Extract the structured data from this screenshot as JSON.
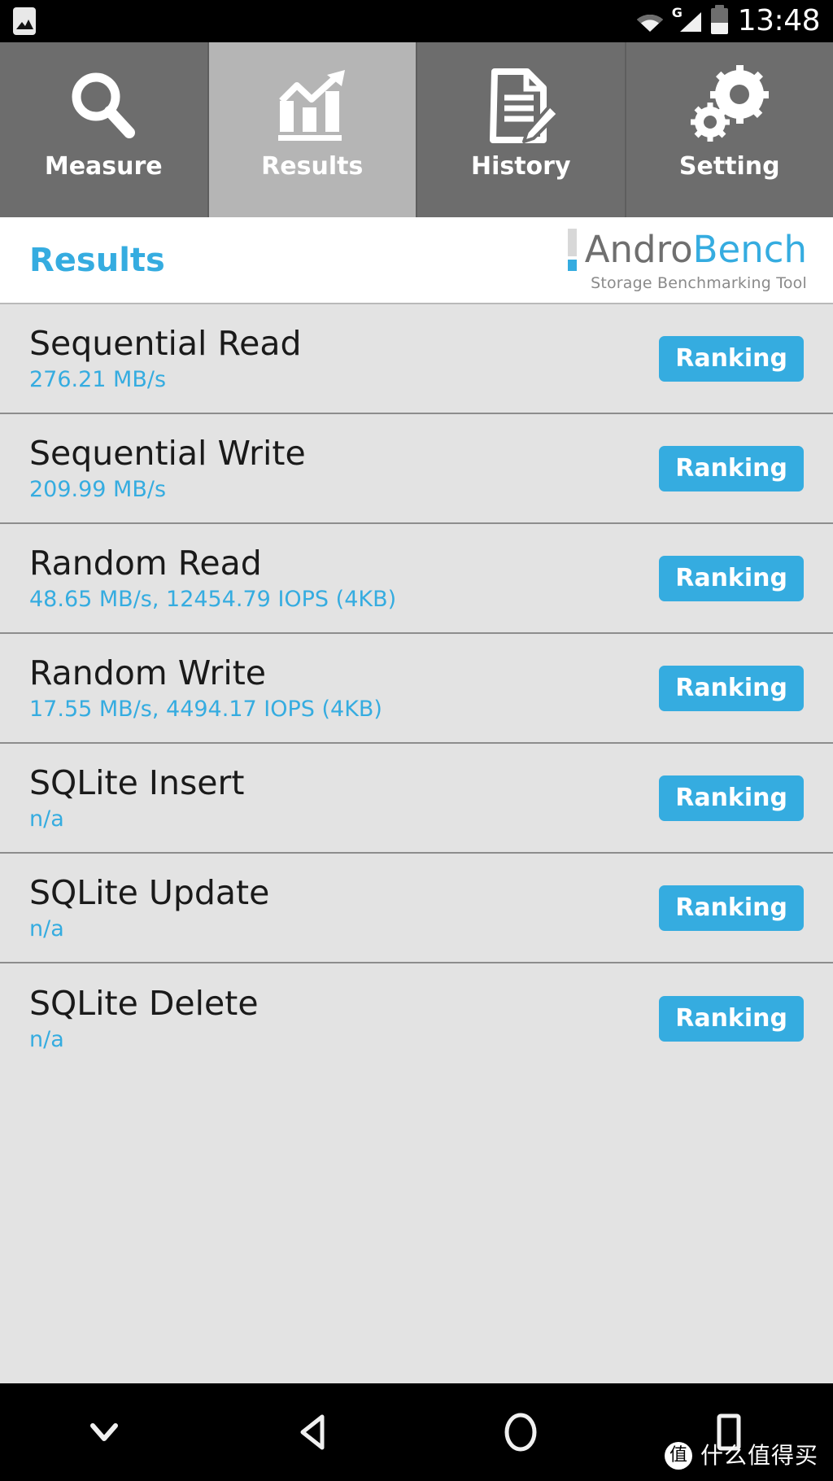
{
  "status_bar": {
    "time": "13:48",
    "icons": {
      "notification": "gallery-icon",
      "wifi": "wifi-icon",
      "signal": "signal-icon",
      "network_type": "G",
      "battery": "battery-icon"
    }
  },
  "tabs": [
    {
      "label": "Measure",
      "icon": "magnifier-icon",
      "active": false
    },
    {
      "label": "Results",
      "icon": "bar-chart-icon",
      "active": true
    },
    {
      "label": "History",
      "icon": "document-pen-icon",
      "active": false
    },
    {
      "label": "Setting",
      "icon": "gears-icon",
      "active": false
    }
  ],
  "header": {
    "title": "Results",
    "logo_part1": "Andro",
    "logo_part2": "Bench",
    "tagline": "Storage Benchmarking Tool"
  },
  "results": {
    "button_label": "Ranking",
    "rows": [
      {
        "title": "Sequential Read",
        "value": "276.21 MB/s"
      },
      {
        "title": "Sequential Write",
        "value": "209.99 MB/s"
      },
      {
        "title": "Random Read",
        "value": "48.65 MB/s, 12454.79 IOPS (4KB)"
      },
      {
        "title": "Random Write",
        "value": "17.55 MB/s, 4494.17 IOPS (4KB)"
      },
      {
        "title": "SQLite Insert",
        "value": "n/a"
      },
      {
        "title": "SQLite Update",
        "value": "n/a"
      },
      {
        "title": "SQLite Delete",
        "value": "n/a"
      }
    ]
  },
  "nav_bar": {
    "buttons": [
      {
        "name": "hide-keyboard-button",
        "icon": "chevron-down-icon"
      },
      {
        "name": "back-button",
        "icon": "triangle-back-icon"
      },
      {
        "name": "home-button",
        "icon": "circle-home-icon"
      },
      {
        "name": "recents-button",
        "icon": "square-recents-icon"
      }
    ]
  },
  "watermark": {
    "badge": "值",
    "text": "什么值得买"
  },
  "colors": {
    "accent_blue": "#35ACE0",
    "tab_inactive": "#6d6d6d",
    "tab_active": "#b5b5b5",
    "list_bg": "#e3e3e3"
  }
}
